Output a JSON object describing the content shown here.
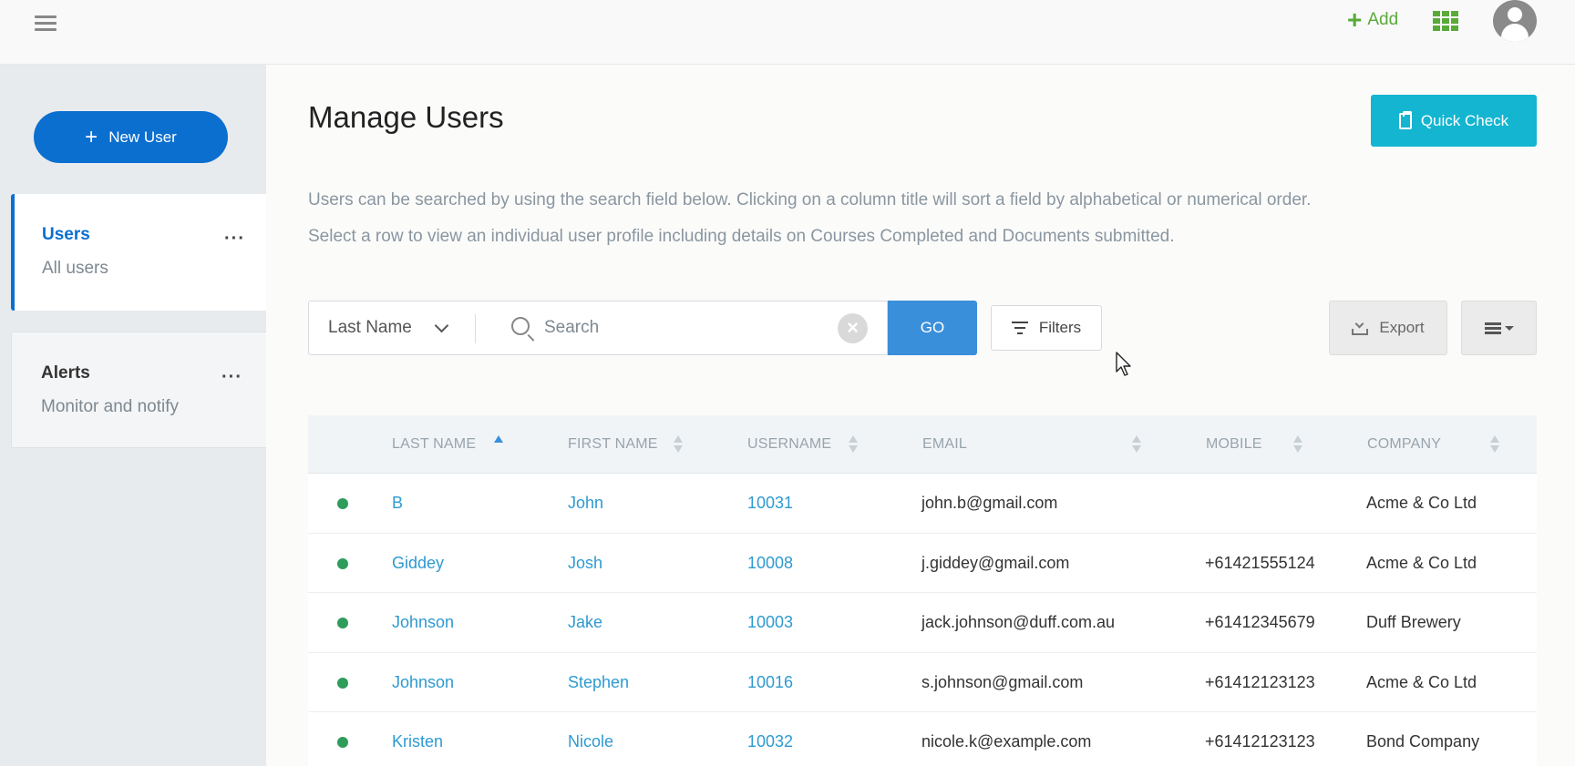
{
  "header": {
    "add_label": "Add"
  },
  "sidebar": {
    "new_user_label": "New User",
    "cards": [
      {
        "title": "Users",
        "subtitle": "All users"
      },
      {
        "title": "Alerts",
        "subtitle": "Monitor and notify"
      }
    ],
    "more_label": "···"
  },
  "main": {
    "title": "Manage Users",
    "quick_check_label": "Quick Check",
    "description_line1": "Users can be searched by using the search field below. Clicking on a column title will sort a field by alphabetical or numerical order.",
    "description_line2": "Select a row to view an individual user profile including details on Courses Completed and Documents submitted.",
    "search": {
      "field_selected": "Last Name",
      "placeholder": "Search",
      "value": "",
      "clear_glyph": "×",
      "go_label": "GO"
    },
    "filters_label": "Filters",
    "export_label": "Export"
  },
  "table": {
    "columns": [
      "LAST NAME",
      "FIRST NAME",
      "USERNAME",
      "EMAIL",
      "MOBILE",
      "COMPANY"
    ],
    "sorted_column": "LAST NAME",
    "sort_direction": "ascending",
    "status_color": "#2e9c5a",
    "rows": [
      {
        "last_name": "B",
        "first_name": "John",
        "username": "10031",
        "email": "john.b@gmail.com",
        "mobile": "",
        "company": "Acme & Co Ltd"
      },
      {
        "last_name": "Giddey",
        "first_name": "Josh",
        "username": "10008",
        "email": "j.giddey@gmail.com",
        "mobile": "+61421555124",
        "company": "Acme & Co Ltd"
      },
      {
        "last_name": "Johnson",
        "first_name": "Jake",
        "username": "10003",
        "email": "jack.johnson@duff.com.au",
        "mobile": "+61412345679",
        "company": "Duff Brewery"
      },
      {
        "last_name": "Johnson",
        "first_name": "Stephen",
        "username": "10016",
        "email": "s.johnson@gmail.com",
        "mobile": "+61412123123",
        "company": "Acme & Co Ltd"
      },
      {
        "last_name": "Kristen",
        "first_name": "Nicole",
        "username": "10032",
        "email": "nicole.k@example.com",
        "mobile": "+61412123123",
        "company": "Bond Company"
      }
    ]
  },
  "colors": {
    "primary_blue": "#0b6fd0",
    "quick_check": "#14b5d0",
    "go_button": "#3a8fdb",
    "add_green": "#5aaa3a",
    "link_blue": "#2e9ad0"
  }
}
